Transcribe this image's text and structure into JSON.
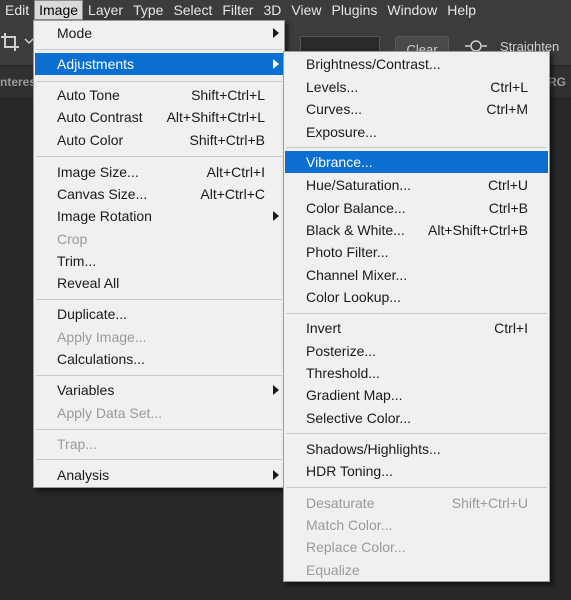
{
  "menubar": {
    "items": [
      "Edit",
      "Image",
      "Layer",
      "Type",
      "Select",
      "Filter",
      "3D",
      "View",
      "Plugins",
      "Window",
      "Help"
    ],
    "active_index": 1
  },
  "options_bar": {
    "clear_label": "Clear",
    "straighten_label": "Straighten",
    "crop_icon": "crop-icon",
    "level_icon": "straighten-level-icon"
  },
  "document_tabs": {
    "left_fragment": "nteres",
    "right_fragment": "RG"
  },
  "image_menu": {
    "items": [
      {
        "label": "Mode",
        "submenu": true
      },
      {
        "label": "Adjustments",
        "submenu": true,
        "highlighted": true
      },
      {
        "label": "Auto Tone",
        "shortcut": "Shift+Ctrl+L"
      },
      {
        "label": "Auto Contrast",
        "shortcut": "Alt+Shift+Ctrl+L"
      },
      {
        "label": "Auto Color",
        "shortcut": "Shift+Ctrl+B"
      },
      {
        "label": "Image Size...",
        "shortcut": "Alt+Ctrl+I"
      },
      {
        "label": "Canvas Size...",
        "shortcut": "Alt+Ctrl+C"
      },
      {
        "label": "Image Rotation",
        "submenu": true
      },
      {
        "label": "Crop",
        "disabled": true
      },
      {
        "label": "Trim..."
      },
      {
        "label": "Reveal All"
      },
      {
        "label": "Duplicate..."
      },
      {
        "label": "Apply Image...",
        "disabled": true
      },
      {
        "label": "Calculations..."
      },
      {
        "label": "Variables",
        "submenu": true
      },
      {
        "label": "Apply Data Set...",
        "disabled": true
      },
      {
        "label": "Trap...",
        "disabled": true
      },
      {
        "label": "Analysis",
        "submenu": true
      }
    ]
  },
  "adjustments_menu": {
    "items": [
      {
        "label": "Brightness/Contrast..."
      },
      {
        "label": "Levels...",
        "shortcut": "Ctrl+L"
      },
      {
        "label": "Curves...",
        "shortcut": "Ctrl+M"
      },
      {
        "label": "Exposure..."
      },
      {
        "label": "Vibrance...",
        "highlighted": true
      },
      {
        "label": "Hue/Saturation...",
        "shortcut": "Ctrl+U"
      },
      {
        "label": "Color Balance...",
        "shortcut": "Ctrl+B"
      },
      {
        "label": "Black & White...",
        "shortcut": "Alt+Shift+Ctrl+B"
      },
      {
        "label": "Photo Filter..."
      },
      {
        "label": "Channel Mixer..."
      },
      {
        "label": "Color Lookup..."
      },
      {
        "label": "Invert",
        "shortcut": "Ctrl+I"
      },
      {
        "label": "Posterize..."
      },
      {
        "label": "Threshold..."
      },
      {
        "label": "Gradient Map..."
      },
      {
        "label": "Selective Color..."
      },
      {
        "label": "Shadows/Highlights..."
      },
      {
        "label": "HDR Toning..."
      },
      {
        "label": "Desaturate",
        "shortcut": "Shift+Ctrl+U",
        "disabled": true
      },
      {
        "label": "Match Color...",
        "disabled": true
      },
      {
        "label": "Replace Color...",
        "disabled": true
      },
      {
        "label": "Equalize",
        "disabled": true
      }
    ]
  },
  "colors": {
    "highlight": "#0a6fd1",
    "menu_bg": "#f0f0f0",
    "app_bg": "#3c3c3c",
    "disabled_text": "#9a9a9a"
  }
}
